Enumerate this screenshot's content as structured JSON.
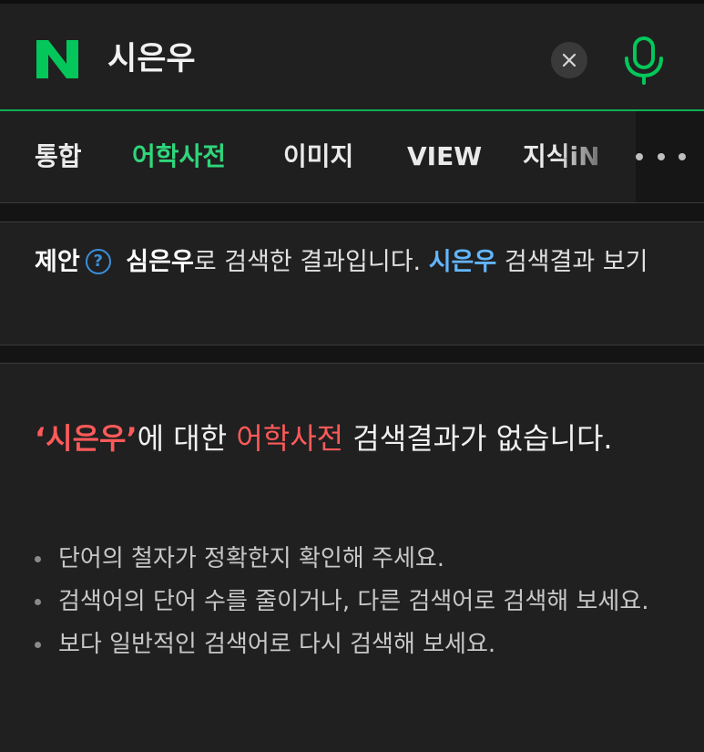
{
  "header": {
    "logo_letter": "N",
    "query": "시은우",
    "clear_icon": "close-icon",
    "mic_icon": "microphone-icon"
  },
  "tabs": [
    {
      "label": "통합",
      "active": false
    },
    {
      "label": "어학사전",
      "active": true
    },
    {
      "label": "이미지",
      "active": false
    },
    {
      "label": "VIEW",
      "active": false
    },
    {
      "label": "지식iN",
      "active": false
    }
  ],
  "more_icon": "more-dots-icon",
  "suggestion": {
    "label": "제안",
    "help_icon": "?",
    "corrected": "심은우",
    "text_mid": "로 검색한 결과입니다. ",
    "original_link": "시은우",
    "text_end": " 검색결과 보기"
  },
  "no_result": {
    "quote_open": "‘",
    "query": "시은우",
    "quote_close": "’",
    "text_a": "에 대한 ",
    "section": "어학사전",
    "text_b": " 검색결과가 없습니다."
  },
  "tips": [
    "단어의 철자가 정확한지 확인해 주세요.",
    "검색어의 단어 수를 줄이거나, 다른 검색어로 검색해 보세요.",
    "보다 일반적인 검색어로 다시 검색해 보세요."
  ],
  "colors": {
    "brand_green": "#03c75a",
    "active_tab": "#2fd67b",
    "link_blue": "#62b6ff",
    "highlight_red": "#ff5a5a"
  }
}
